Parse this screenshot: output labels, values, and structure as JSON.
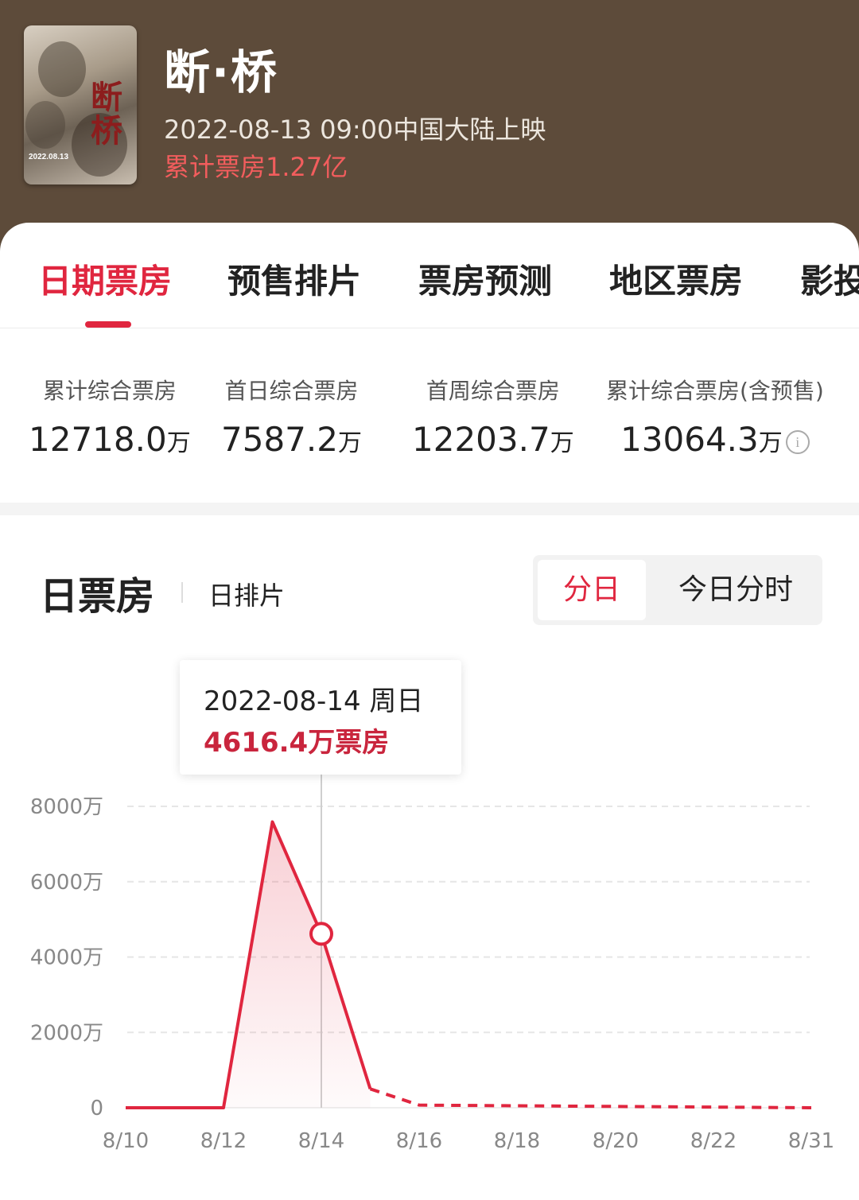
{
  "movie": {
    "title": "断·桥",
    "release": "2022-08-13 09:00中国大陆上映",
    "total_box": "累计票房1.27亿",
    "poster": {
      "title_text": "断桥",
      "date_text": "2022.08.13"
    }
  },
  "tabs": [
    {
      "label": "日期票房",
      "active": true
    },
    {
      "label": "预售排片",
      "active": false
    },
    {
      "label": "票房预测",
      "active": false
    },
    {
      "label": "地区票房",
      "active": false
    },
    {
      "label": "影投",
      "active": false
    }
  ],
  "stats": [
    {
      "label": "累计综合票房",
      "value": "12718.0",
      "unit": "万"
    },
    {
      "label": "首日综合票房",
      "value": "7587.2",
      "unit": "万"
    },
    {
      "label": "首周综合票房",
      "value": "12203.7",
      "unit": "万"
    },
    {
      "label": "累计综合票房(含预售)",
      "value": "13064.3",
      "unit": "万"
    }
  ],
  "section": {
    "title": "日票房",
    "sub": "日排片",
    "toggle": {
      "selected": "分日",
      "other": "今日分时"
    }
  },
  "tooltip": {
    "date": "2022-08-14 周日",
    "value": "4616.4万票房"
  },
  "colors": {
    "accent": "#e0263f",
    "header_bg": "#5d4b3a",
    "highlight": "#f25d5d"
  },
  "chart_data": {
    "type": "line",
    "x_tick_labels": [
      "8/10",
      "8/12",
      "8/14",
      "8/16",
      "8/18",
      "8/20",
      "8/22",
      "8/31"
    ],
    "y_tick_labels": [
      "0",
      "2000万",
      "4000万",
      "6000万",
      "8000万"
    ],
    "ylim": [
      0,
      8000
    ],
    "unit": "万",
    "points": [
      {
        "x": "8/10",
        "y": 0
      },
      {
        "x": "8/11",
        "y": 0
      },
      {
        "x": "8/12",
        "y": 0
      },
      {
        "x": "8/13",
        "y": 7587.2
      },
      {
        "x": "8/14",
        "y": 4616.4
      },
      {
        "x": "8/15",
        "y": 500
      }
    ],
    "projected_points": [
      {
        "x": "8/15",
        "y": 500
      },
      {
        "x": "8/16",
        "y": 70
      },
      {
        "x": "8/31",
        "y": 0
      }
    ],
    "highlight": {
      "x": "8/14",
      "y": 4616.4
    },
    "grid": true
  }
}
